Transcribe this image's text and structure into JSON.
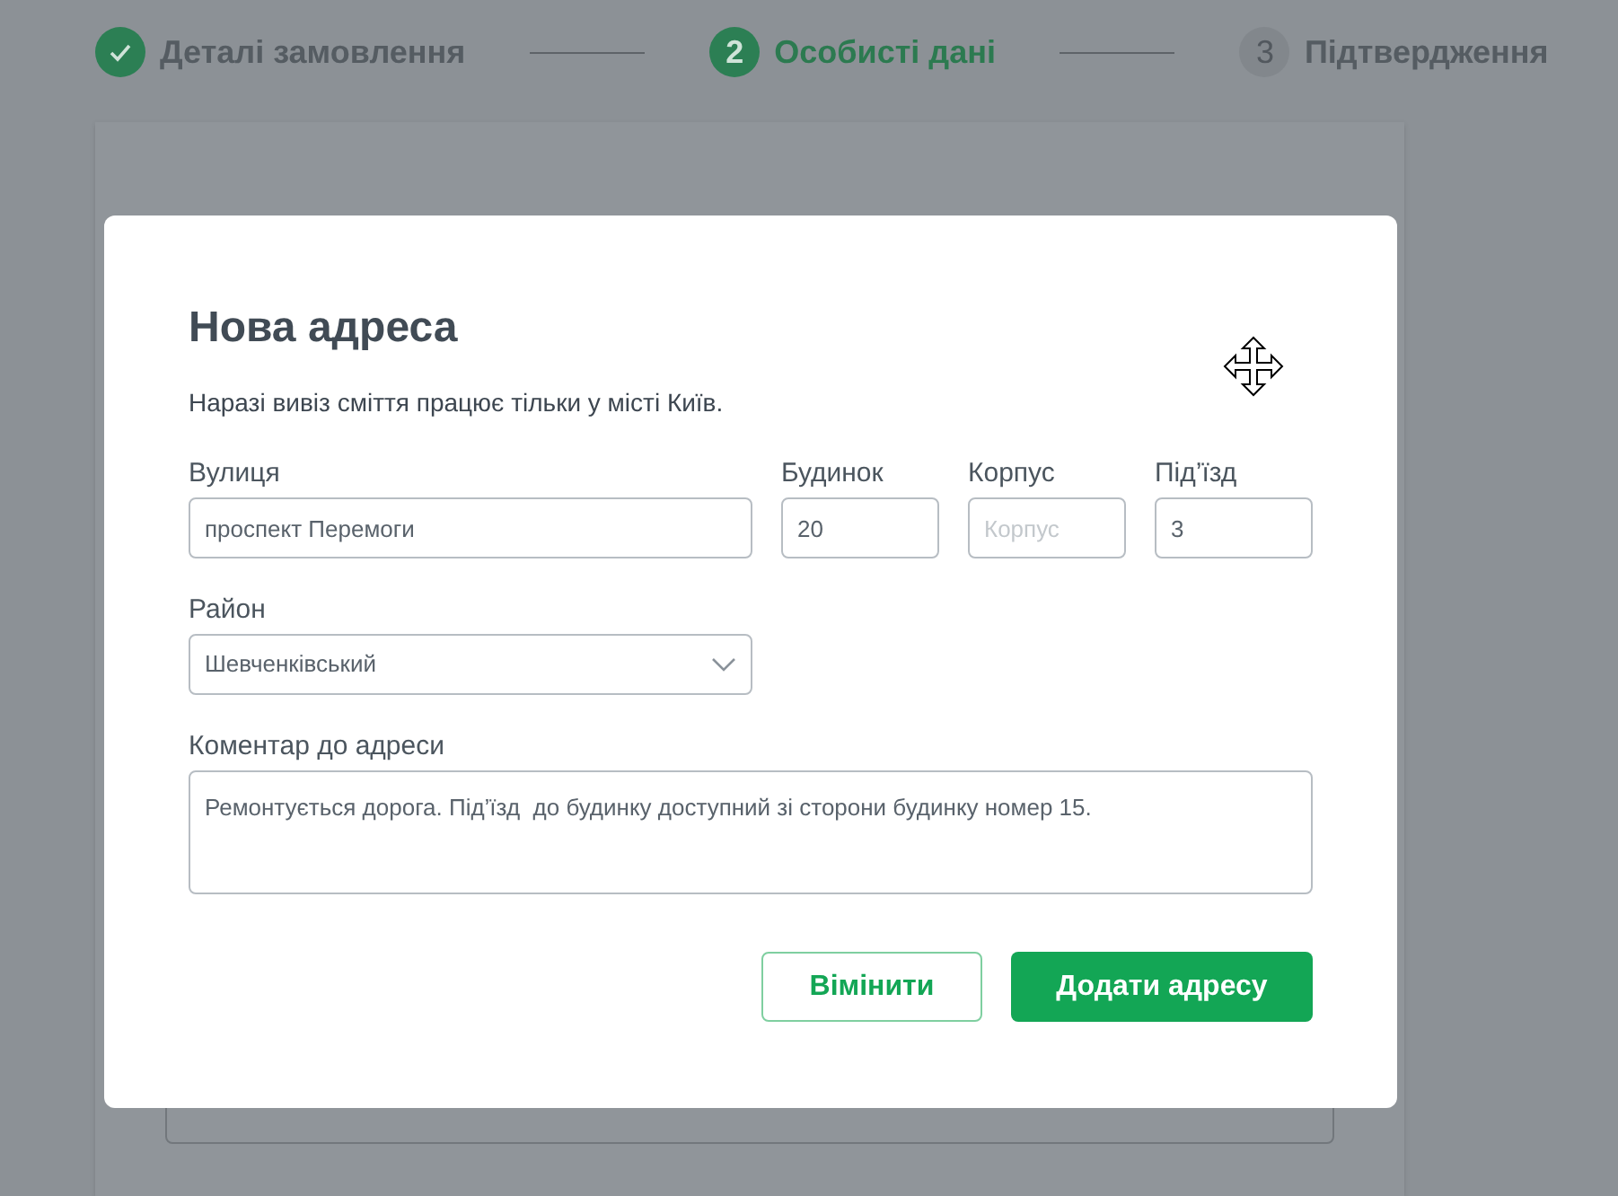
{
  "stepper": [
    {
      "kind": "done",
      "label": "Деталі замовлення"
    },
    {
      "kind": "active",
      "number": "2",
      "label": "Особисті дані"
    },
    {
      "kind": "pending",
      "number": "3",
      "label": "Підтвердження"
    }
  ],
  "dialog": {
    "title": "Нова адреса",
    "note": "Наразі вивіз сміття працює тільки у місті Київ.",
    "fields": [
      {
        "kind": "text",
        "label": "Вулиця",
        "value": "проспект Перемоги"
      },
      {
        "kind": "text",
        "label": "Будинок",
        "value": "20"
      },
      {
        "kind": "text",
        "label": "Корпус",
        "placeholder": "Корпус"
      },
      {
        "kind": "text",
        "label": "Під’їзд",
        "value": "3"
      },
      {
        "kind": "select",
        "label": "Район",
        "value": "Шевченківський"
      },
      {
        "kind": "textarea",
        "label": "Коментар до адреси",
        "value": "Ремонтується дорога. Під’їзд  до будинку доступний зі сторони будинку номер 15."
      }
    ],
    "buttons": [
      {
        "kind": "secondary",
        "label": "Вімінити"
      },
      {
        "kind": "primary",
        "label": "Додати адресу"
      }
    ]
  }
}
